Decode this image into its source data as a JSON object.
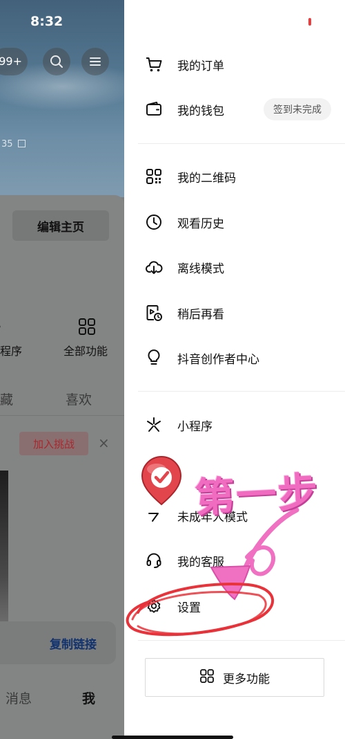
{
  "status_bar": {
    "time": "8:32"
  },
  "profile_bg": {
    "notification_badge": "99+",
    "account_id_fragment": "35",
    "edit_profile_label": "编辑主页",
    "functions": [
      {
        "label": "程序",
        "icon": "mini-program-icon"
      },
      {
        "label": "全部功能",
        "icon": "grid-icon"
      }
    ],
    "tabs": [
      "藏",
      "喜欢"
    ],
    "join_challenge_label": "加入挑战",
    "close_symbol": "×",
    "copy_link_label": "复制链接",
    "bottom_nav": [
      "消息",
      "我"
    ]
  },
  "drawer": {
    "section1": [
      {
        "label": "我的订单",
        "icon": "cart-icon"
      },
      {
        "label": "我的钱包",
        "icon": "wallet-icon",
        "pill": "签到未完成"
      }
    ],
    "section2": [
      {
        "label": "我的二维码",
        "icon": "qr-code-icon"
      },
      {
        "label": "观看历史",
        "icon": "clock-icon"
      },
      {
        "label": "离线模式",
        "icon": "cloud-download-icon"
      },
      {
        "label": "稍后再看",
        "icon": "watch-later-icon"
      },
      {
        "label": "抖音创作者中心",
        "icon": "lightbulb-icon"
      }
    ],
    "section3": [
      {
        "label": "小程序",
        "icon": "mini-program-icon"
      },
      {
        "label": "未成年人模式",
        "icon": "minor-mode-icon"
      },
      {
        "label": "我的客服",
        "icon": "headset-icon"
      },
      {
        "label": "设置",
        "icon": "gear-icon"
      }
    ],
    "more_label": "更多功能",
    "more_icon": "grid-icon"
  },
  "annotation": {
    "text": "第一步",
    "color": "#f06cc0",
    "circle_color": "#e8333a"
  }
}
